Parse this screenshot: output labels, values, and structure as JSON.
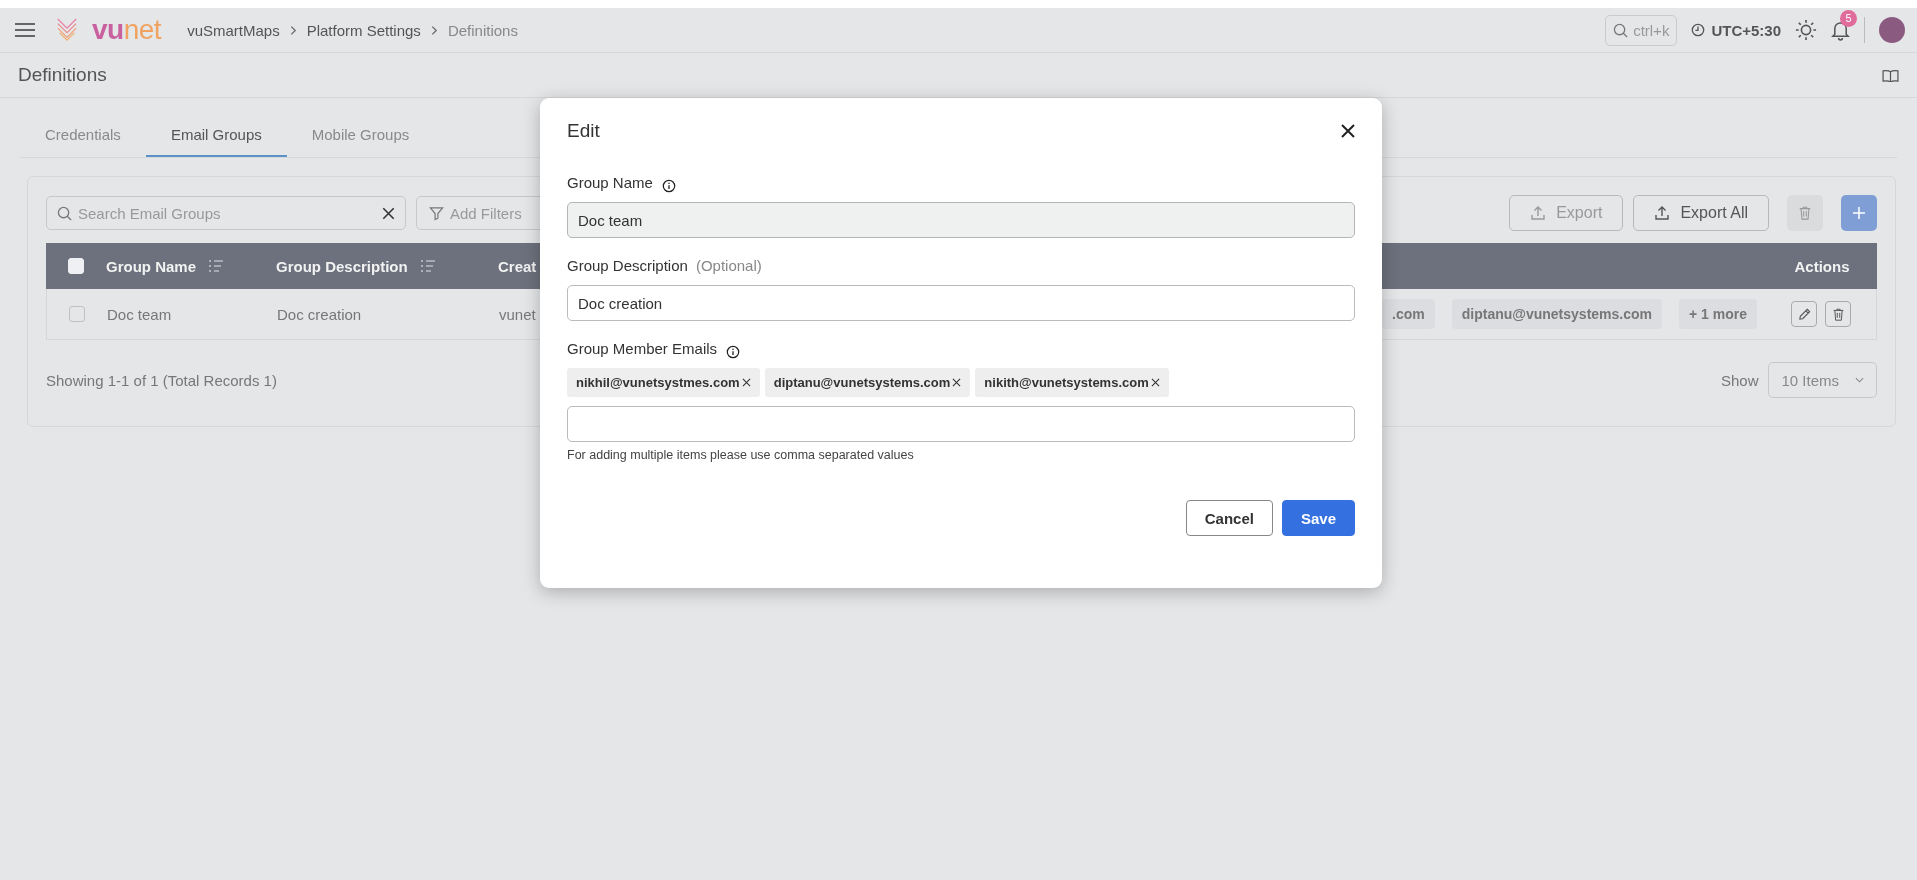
{
  "header": {
    "logo": {
      "part_1": "vu",
      "part_2": "net"
    },
    "breadcrumbs": [
      {
        "label": "vuSmartMaps",
        "current": false
      },
      {
        "label": "Platform Settings",
        "current": false
      },
      {
        "label": "Definitions",
        "current": true
      }
    ],
    "search_hint": "ctrl+k",
    "timezone": "UTC+5:30",
    "notification_count": "5"
  },
  "page_title": "Definitions",
  "tabs": [
    {
      "label": "Credentials",
      "selected": false
    },
    {
      "label": "Email Groups",
      "selected": true
    },
    {
      "label": "Mobile Groups",
      "selected": false
    }
  ],
  "toolbar": {
    "search_placeholder": "Search Email Groups",
    "filter_label": "Add Filters",
    "buttons": [
      {
        "kind": "export",
        "label": "Export",
        "disabled": true
      },
      {
        "kind": "export",
        "label": "Export All",
        "disabled": false
      },
      {
        "kind": "delete",
        "disabled": true
      },
      {
        "kind": "add",
        "disabled": true
      }
    ]
  },
  "table": {
    "header_checked": false,
    "columns": [
      {
        "label": "Group Name",
        "sortable": true
      },
      {
        "label": "Group Description",
        "sortable": true
      },
      {
        "label": "Creat"
      },
      {
        "label": "Actions",
        "sortable": false
      }
    ],
    "rows": [
      {
        "checked": false,
        "name": "Doc team",
        "description": "Doc creation",
        "column_3": "vunet",
        "emails": [
          ".com",
          "diptanu@vunetsystems.com",
          "+ 1 more"
        ]
      }
    ]
  },
  "footer": {
    "summary": "Showing 1-1 of 1 (Total Records 1)",
    "show_label": "Show",
    "page_size": "10 Items"
  },
  "modal": {
    "title": "Edit",
    "fields": [
      {
        "label": "Group Name",
        "info": true,
        "value": "Doc team",
        "disabled": true
      },
      {
        "label": "Group Description",
        "note": "(Optional)",
        "info": false,
        "value": "Doc creation",
        "disabled": false
      }
    ],
    "emails_label": "Group Member Emails",
    "emails_info": true,
    "emails": [
      "nikhil@vunetsystmes.com",
      "diptanu@vunetsystems.com",
      "nikith@vunetsystems.com"
    ],
    "hint": "For adding multiple items please use comma separated values",
    "buttons": [
      {
        "kind": "secondary",
        "label": "Cancel"
      },
      {
        "kind": "primary",
        "label": "Save"
      }
    ]
  }
}
